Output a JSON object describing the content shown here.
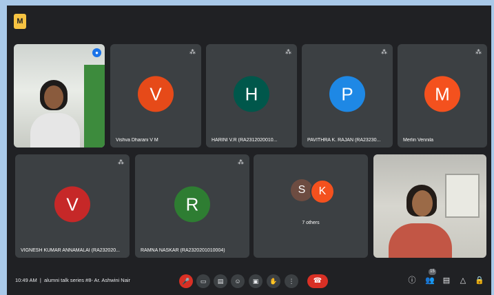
{
  "app": {
    "logo_label": "M"
  },
  "participants": [
    {
      "name": "",
      "initial": "",
      "video": true,
      "speaking_icon": "microphone-icon"
    },
    {
      "name": "Vishva Dharani V M",
      "initial": "V",
      "color": "#e64a19"
    },
    {
      "name": "HARINI V.R (RA2312020010...",
      "initial": "H",
      "color": "#00574b"
    },
    {
      "name": "PAVITHRA K. RAJAN (RA23230...",
      "initial": "P",
      "color": "#1e88e5"
    },
    {
      "name": "Merlin Vennila",
      "initial": "M",
      "color": "#f4511e"
    },
    {
      "name": "VIGNESH KUMAR ANNAMALAI (RA232020...",
      "initial": "V",
      "color": "#c62828"
    },
    {
      "name": "RAMNA NASKAR (RA2320201010004)",
      "initial": "R",
      "color": "#2e7d32"
    },
    {
      "name": "7 others",
      "initials": [
        "S",
        "K"
      ],
      "colors": [
        "#6d4c41",
        "#f4511e"
      ]
    },
    {
      "name": "",
      "video": true
    }
  ],
  "bottom_bar": {
    "time": "10:49 AM",
    "separator": "|",
    "meeting_title": "alumni talk series #8- Ar. Ashwini Nair",
    "participant_count": "15"
  },
  "controls": [
    "microphone-off-icon",
    "camera-icon",
    "captions-icon",
    "emoji-icon",
    "present-icon",
    "hand-raise-icon",
    "more-options-icon"
  ],
  "colors": {
    "background": "#202124",
    "tile": "#3c4043",
    "end_call": "#d93025"
  }
}
